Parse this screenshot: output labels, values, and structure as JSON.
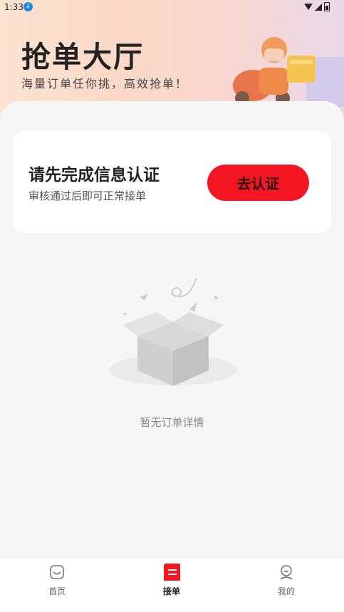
{
  "status_bar": {
    "time": "1:33"
  },
  "hero": {
    "title": "抢单大厅",
    "subtitle": "海量订单任你挑，高效抢单！"
  },
  "verify_card": {
    "title": "请先完成信息认证",
    "subtitle": "审核通过后即可正常接单",
    "button_label": "去认证"
  },
  "empty_state": {
    "text": "暂无订单详情"
  },
  "tabbar": {
    "items": [
      {
        "label": "首页",
        "icon": "home-icon",
        "active": false
      },
      {
        "label": "接单",
        "icon": "order-icon",
        "active": true
      },
      {
        "label": "我的",
        "icon": "profile-icon",
        "active": false
      }
    ]
  },
  "colors": {
    "accent": "#f51624"
  }
}
